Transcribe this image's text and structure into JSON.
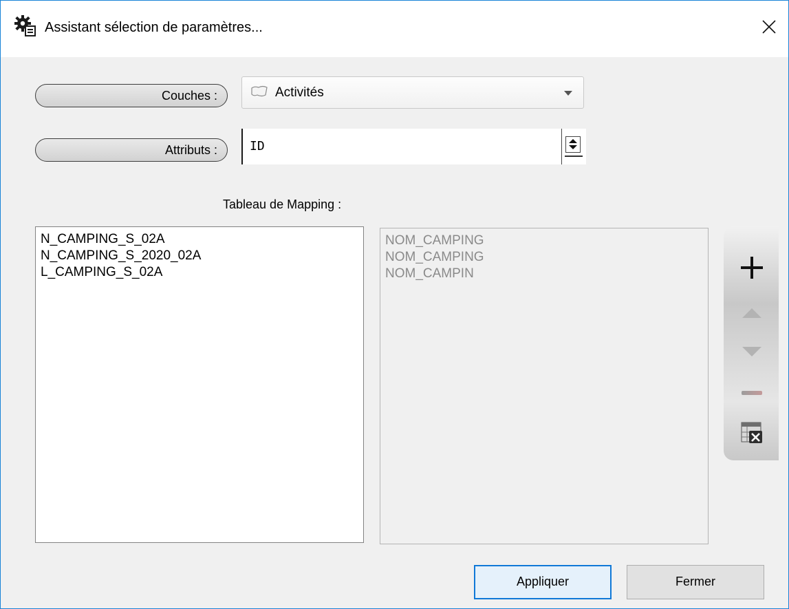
{
  "window": {
    "title": "Assistant sélection de paramètres...",
    "accent_color": "#1883d7"
  },
  "form": {
    "couches_label": "Couches :",
    "couches_value": "Activités",
    "attributs_label": "Attributs :",
    "attributs_value": "ID"
  },
  "mapping": {
    "title": "Tableau de Mapping :",
    "left_items": [
      "N_CAMPING_S_02A",
      "N_CAMPING_S_2020_02A",
      "L_CAMPING_S_02A"
    ],
    "right_items": [
      "NOM_CAMPING",
      "NOM_CAMPING",
      "NOM_CAMPIN"
    ]
  },
  "toolbar": {
    "icons": [
      "plus-icon",
      "arrow-up-icon",
      "arrow-down-icon",
      "minus-icon",
      "clear-table-icon"
    ]
  },
  "buttons": {
    "apply_mnemonic": "A",
    "apply_rest": "ppliquer",
    "close_mnemonic": "F",
    "close_rest": "ermer"
  }
}
